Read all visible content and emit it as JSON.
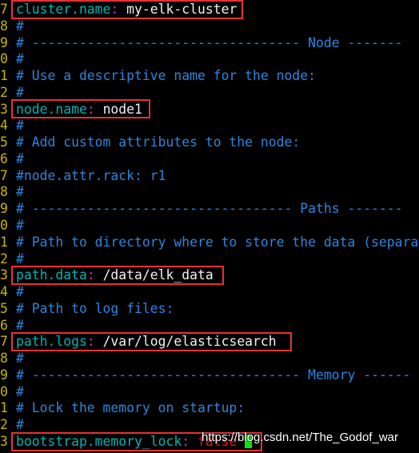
{
  "line_numbers": [
    "7",
    "8",
    "9",
    "0",
    "1",
    "2",
    "3",
    "4",
    "5",
    "6",
    "7",
    "8",
    "9",
    "0",
    "1",
    "2",
    "3",
    "4",
    "5",
    "6",
    "7",
    "8",
    "9",
    "0",
    "1",
    "2",
    "3"
  ],
  "lines": [
    {
      "type": "kv",
      "key": "cluster.name",
      "value": "my-elk-cluster",
      "boxed": true
    },
    {
      "type": "comment",
      "text": "#"
    },
    {
      "type": "comment",
      "text": "# ---------------------------------- Node -------"
    },
    {
      "type": "comment",
      "text": "#"
    },
    {
      "type": "comment",
      "text": "# Use a descriptive name for the node:"
    },
    {
      "type": "comment",
      "text": "#"
    },
    {
      "type": "kv",
      "key": "node.name",
      "value": "node1",
      "boxed": true
    },
    {
      "type": "comment",
      "text": "#"
    },
    {
      "type": "comment",
      "text": "# Add custom attributes to the node:"
    },
    {
      "type": "comment",
      "text": "#"
    },
    {
      "type": "comment",
      "text": "#node.attr.rack: r1"
    },
    {
      "type": "comment",
      "text": "#"
    },
    {
      "type": "comment",
      "text": "# --------------------------------- Paths -------"
    },
    {
      "type": "comment",
      "text": "#"
    },
    {
      "type": "comment",
      "text": "# Path to directory where to store the data (separa"
    },
    {
      "type": "comment",
      "text": "#"
    },
    {
      "type": "kv",
      "key": "path.data",
      "value": "/data/elk_data",
      "boxed": true
    },
    {
      "type": "comment",
      "text": "#"
    },
    {
      "type": "comment",
      "text": "# Path to log files:"
    },
    {
      "type": "comment",
      "text": "#"
    },
    {
      "type": "kv",
      "key": "path.logs",
      "value": "/var/log/elasticsearch",
      "boxed": true
    },
    {
      "type": "comment",
      "text": "#"
    },
    {
      "type": "comment",
      "text": "# ---------------------------------- Memory ------"
    },
    {
      "type": "comment",
      "text": "#"
    },
    {
      "type": "comment",
      "text": "# Lock the memory on startup:"
    },
    {
      "type": "comment",
      "text": "#"
    },
    {
      "type": "kv",
      "key": "bootstrap.memory_lock",
      "value": "false",
      "boxed": true,
      "value_color": "#e02020",
      "cursor": true
    }
  ],
  "watermark": "https://blog.csdn.net/The_Godof_war",
  "colors": {
    "line_number": "#c8b400",
    "key": "#00b4b4",
    "comment": "#2a86e0",
    "colon": "#c030c0",
    "value": "#f0f0f0",
    "highlight_box": "#e8303a",
    "cursor": "#10e010"
  }
}
